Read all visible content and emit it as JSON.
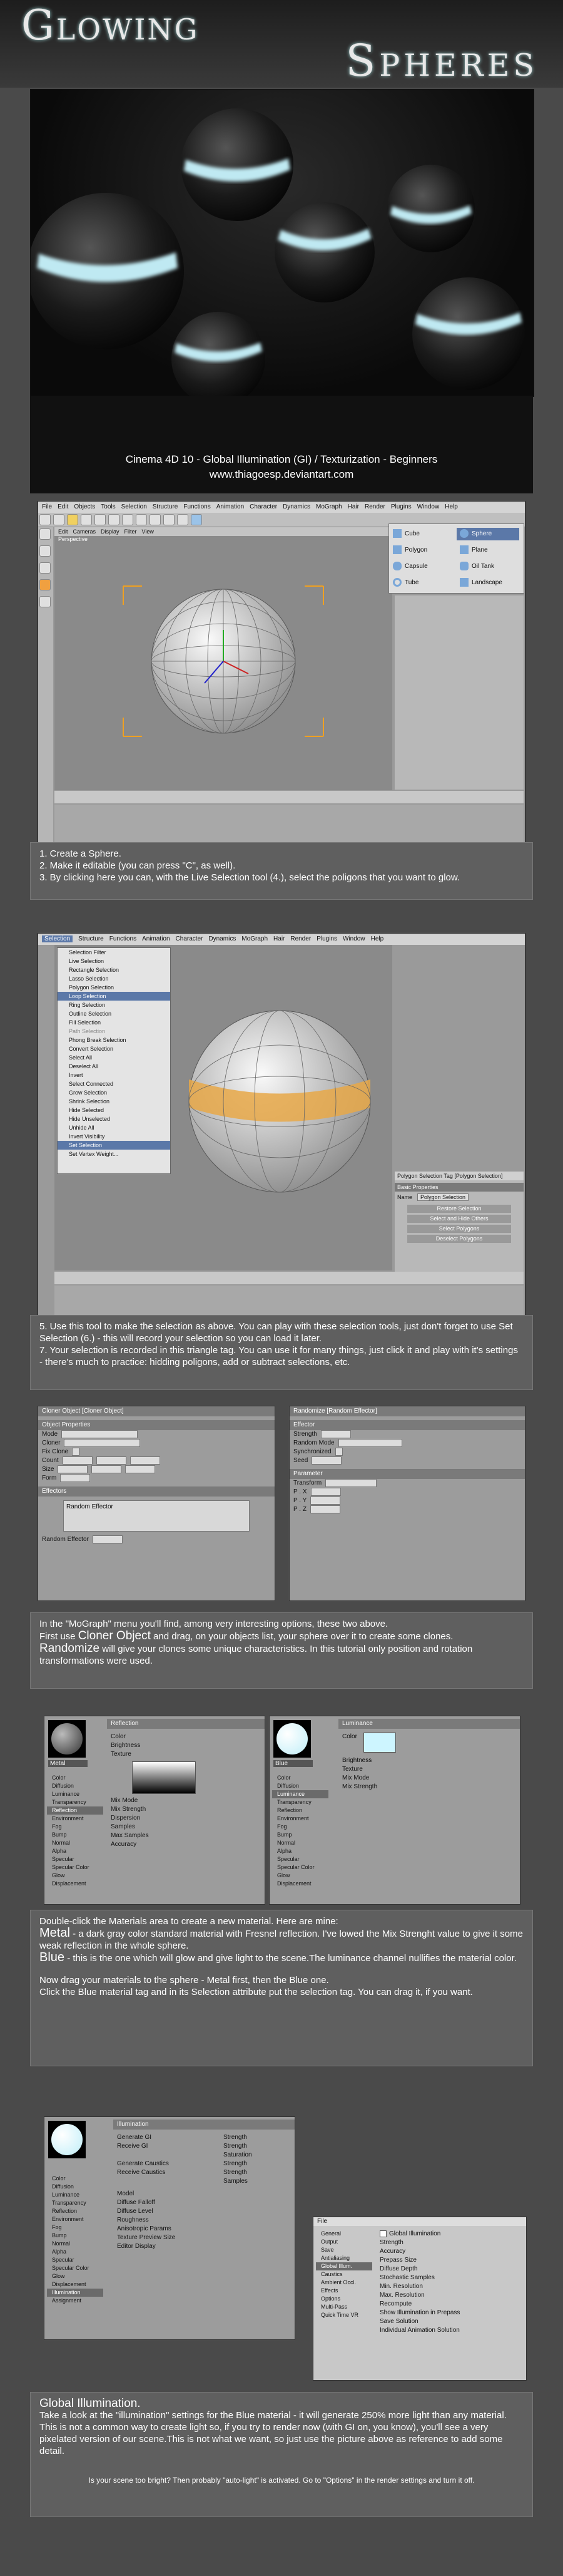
{
  "title_top": "Glowing",
  "title_bottom": "Spheres",
  "intro": {
    "line1": "Cinema 4D 10 - Global Illumination (GI) / Texturization - Beginners",
    "line2": "www.thiagoesp.deviantart.com"
  },
  "c4d_menu": [
    "File",
    "Edit",
    "Objects",
    "Tools",
    "Selection",
    "Structure",
    "Functions",
    "Animation",
    "Character",
    "Dynamics",
    "MoGraph",
    "Hair",
    "Render",
    "Plugins",
    "Window",
    "Help"
  ],
  "viewport_menu": [
    "Edit",
    "Cameras",
    "Display",
    "Filter",
    "View"
  ],
  "viewport_label": "Perspective",
  "primitives": [
    "Cube",
    "Sphere",
    "Polygon",
    "Plane",
    "Capsule",
    "Oil Tank",
    "Tube",
    "Landscape"
  ],
  "step1": {
    "l1": "1. Create a Sphere.",
    "l2": "2. Make it editable (you can press \"C\", as well).",
    "l3": "3. By clicking here you can, with the Live Selection tool (4.),  select the poligons that you want to glow."
  },
  "selection_menu": {
    "title": "Selection",
    "items": [
      "Selection Filter",
      "Live Selection",
      "Rectangle Selection",
      "Lasso Selection",
      "Polygon Selection",
      "Loop Selection",
      "Ring Selection",
      "Outline Selection",
      "Fill Selection",
      "Path Selection",
      "Phong Break Selection",
      "Convert Selection",
      "Select All",
      "Deselect All",
      "Invert",
      "Select Connected",
      "Grow Selection",
      "Shrink Selection",
      "Hide Selected",
      "Hide Unselected",
      "Unhide All",
      "Invert Visibility",
      "Set Selection",
      "Set Vertex Weight..."
    ],
    "highlight": "Loop Selection"
  },
  "attributes": {
    "tag_label": "Polygon Selection Tag [Polygon Selection]",
    "basic": "Basic Properties",
    "name_label": "Name",
    "name_value": "Polygon Selection",
    "buttons": [
      "Restore Selection",
      "Select and Hide Others",
      "Select Polygons",
      "Deselect Polygons"
    ]
  },
  "step5": {
    "l1": "5. Use this tool to make the selection as above. You can play with these selection tools, just don't forget to use Set Selection (6.) - this will record your selection so you can load it later.",
    "l2": "7. Your selection is recorded in this triangle tag. You can use it for many things, just click it and play with it's settings - there's much to practice: hidding poligons, add or subtract selections, etc."
  },
  "cloner": {
    "header": "Cloner Object [Cloner Object]",
    "section": "Object Properties",
    "rows": [
      "Mode",
      "Cloner",
      "Fix Clone",
      "Count",
      "Size",
      "Form",
      "Effectors"
    ],
    "effector_label": "Random Effector"
  },
  "randomize": {
    "header": "Randomize [Random Effector]",
    "section": "Effector",
    "rows": [
      "Strength",
      "Random Mode",
      "Synchronized",
      "Seed",
      "Parameter",
      "Transform",
      "P . X",
      "P . Y",
      "P . Z"
    ]
  },
  "mograph_caption": {
    "l1": "In the \"MoGraph\" menu you'll find, among very interesting options, these two above.",
    "l2a": "First use ",
    "cloner": "Cloner Object",
    "l2b": " and drag, on your objects list,  your sphere over it to create some clones.",
    "random": "Randomize",
    "l3b": " will give your clones some unique characteristics. In this tutorial only position and rotation transformations were used."
  },
  "channels": [
    "Color",
    "Diffusion",
    "Luminance",
    "Transparency",
    "Reflection",
    "Environment",
    "Fog",
    "Bump",
    "Normal",
    "Alpha",
    "Specular",
    "Specular Color",
    "Glow",
    "Displacement",
    "Illumination",
    "Assignment"
  ],
  "metal_mat": {
    "name": "Metal",
    "section": "Reflection",
    "fields": [
      "Color",
      "Brightness",
      "Texture",
      "Mix Mode",
      "Mix Strength",
      "Dispersion",
      "Samples",
      "Max Samples",
      "Accuracy"
    ]
  },
  "blue_mat": {
    "name": "Blue",
    "section": "Luminance",
    "fields": [
      "Color",
      "Brightness",
      "Texture",
      "Mix Mode",
      "Mix Strength"
    ]
  },
  "material_caption": {
    "l1": "Double-click the Materials area to create a new material. Here are mine:",
    "metal": "Metal",
    "l2": " - a dark gray color standard material with Fresnel reflection. I've lowed the Mix Strenght value to give it some weak reflection in the whole sphere.",
    "blue": "Blue",
    "l3": " - this is the one which will glow and give light to the scene.The luminance channel nullifies the material color.",
    "l4": "Now drag your materials to the sphere - Metal first, then the Blue one.",
    "l5": "Click the Blue material tag and in its Selection attribute put the selection tag. You can drag it, if you want."
  },
  "illumination": {
    "section": "Illumination",
    "rows": [
      "Generate GI",
      "Receive GI",
      "Generate Caustics",
      "Receive Caustics",
      "Model",
      "Diffuse Falloff",
      "Diffuse Level",
      "Roughness",
      "Anisotropic Params",
      "Texture Preview Size",
      "Editor Display"
    ],
    "right_rows": [
      "Strength",
      "Strength",
      "Saturation",
      "Strength",
      "Strength",
      "Samples"
    ]
  },
  "render": {
    "file_label": "File",
    "nav": [
      "General",
      "Output",
      "Save",
      "Antialiasing",
      "Global Illum.",
      "Caustics",
      "Ambient Occl.",
      "Effects",
      "Options",
      "Multi-Pass",
      "Quick Time VR"
    ],
    "check_label": "Global Illumination",
    "rows": [
      "Strength",
      "Accuracy",
      "Prepass Size",
      "Diffuse Depth",
      "Stochastic Samples",
      "Min. Resolution",
      "Max. Resolution",
      "Recompute",
      "Show Illumination in Prepass",
      "Save Solution",
      "Individual Animation Solution"
    ]
  },
  "gi_caption": {
    "title": "Global Illumination.",
    "l1": "Take a look at the \"illumination\" settings for the Blue material - it will generate 250% more light than any material. This is not a common way to create light so, if you try to render now (with GI on, you know), you'll see a very pixelated version of our scene.This is not what we want, so just use the picture above as reference to add some detail.",
    "note": "Is your scene too bright? Then probably \"auto-light\" is activated. Go to \"Options\" in the render settings and turn it off."
  }
}
